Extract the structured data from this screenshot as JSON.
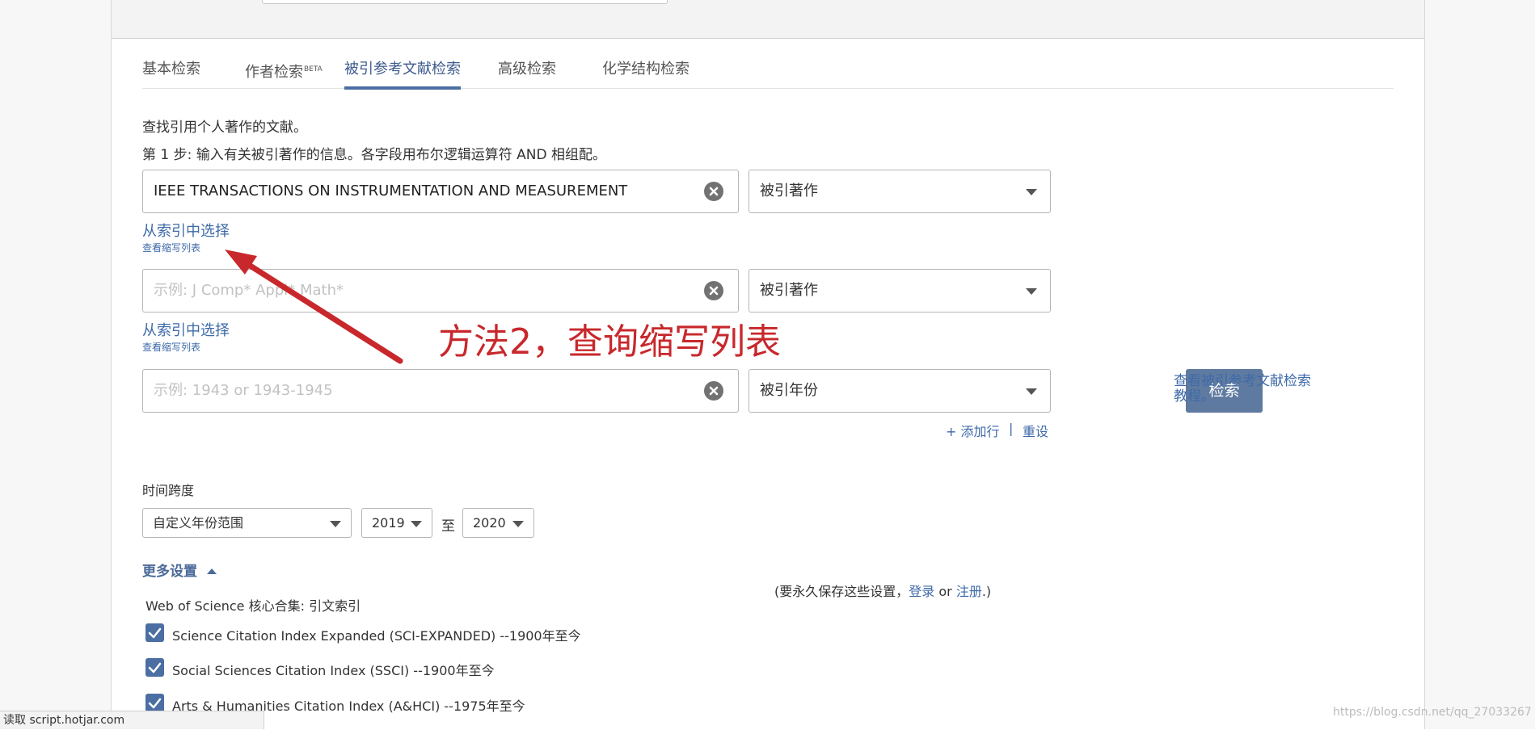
{
  "tabs": [
    {
      "label": "基本检索",
      "sup": ""
    },
    {
      "label": "作者检索",
      "sup": "BETA"
    },
    {
      "label": "被引参考文献检索",
      "sup": ""
    },
    {
      "label": "高级检索",
      "sup": ""
    },
    {
      "label": "化学结构检索",
      "sup": ""
    }
  ],
  "active_tab": "被引参考文献检索",
  "intro": "查找引用个人著作的文献。",
  "step1": "第 1 步: 输入有关被引著作的信息。各字段用布尔逻辑运算符 AND 相组配。",
  "rows": [
    {
      "value": "IEEE TRANSACTIONS ON INSTRUMENTATION AND MEASUREMENT",
      "placeholder": "",
      "field": "被引著作",
      "index_link": "从索引中选择",
      "abbr_link": "查看缩写列表"
    },
    {
      "value": "",
      "placeholder": "示例: J Comp* Appl* Math*",
      "field": "被引著作",
      "index_link": "从索引中选择",
      "abbr_link": "查看缩写列表"
    },
    {
      "value": "",
      "placeholder": "示例: 1943 or 1943-1945",
      "field": "被引年份"
    }
  ],
  "search_button": "检索",
  "tutorial_link": [
    "查看被引参考文献检索",
    "教程。"
  ],
  "add_row": "+ 添加行",
  "separator": "|",
  "reset": "重设",
  "timespan": {
    "label": "时间跨度",
    "range_select": "自定义年份范围",
    "from": "2019",
    "to_label": "至",
    "to": "2020"
  },
  "more_settings": "更多设置",
  "save_note": {
    "prefix": "(要永久保存这些设置，",
    "login": "登录",
    "or": "or",
    "register": "注册",
    "suffix": ".)"
  },
  "collection_label": "Web of Science 核心合集: 引文索引",
  "indexes": [
    {
      "label": "Science Citation Index Expanded (SCI-EXPANDED) --1900年至今",
      "checked": true
    },
    {
      "label": "Social Sciences Citation Index (SSCI) --1900年至今",
      "checked": true
    },
    {
      "label": "Arts & Humanities Citation Index (A&HCI) --1975年至今",
      "checked": true
    }
  ],
  "annotation": "方法2，查询缩写列表",
  "annotation_color": "#c8282c",
  "status_bar": "读取 script.hotjar.com",
  "watermark": "https://blog.csdn.net/qq_27033267",
  "colors": {
    "accent": "#4b6ea3",
    "link": "#3e6aa8",
    "button": "#5f7aa0"
  }
}
